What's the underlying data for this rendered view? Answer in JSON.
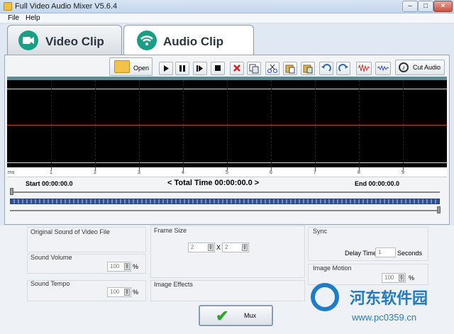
{
  "window": {
    "title": "Full Video Audio Mixer V5.6.4"
  },
  "menu": {
    "items": [
      "File",
      "Help"
    ]
  },
  "tabs": [
    {
      "label": "Video Clip",
      "icon": "camera-icon"
    },
    {
      "label": "Audio Clip",
      "icon": "wifi-icon",
      "selected": true
    }
  ],
  "toolbar": {
    "open_label": "Open",
    "cut_audio_label": "Cut Audio"
  },
  "ruler": {
    "unit": "ms",
    "ticks": [
      "1",
      "2",
      "3",
      "4",
      "5",
      "6",
      "7",
      "8",
      "9"
    ]
  },
  "timeline": {
    "start_label": "Start 00:00:00.0",
    "total_label": "< Total Time 00:00:00.0 >",
    "end_label": "End 00:00:00.0"
  },
  "options": {
    "original_sound_title": "Original Sound of Video File",
    "frame_size_title": "Frame Size",
    "frame_w": "2",
    "frame_x": "X",
    "frame_h": "2",
    "sync_title": "Sync",
    "delay_label": "Delay Time",
    "delay_value": "1",
    "delay_unit": "Seconds",
    "sound_volume_title": "Sound Volume",
    "sound_volume_value": "100",
    "sound_tempo_title": "Sound Tempo",
    "sound_tempo_value": "100",
    "image_effects_title": "Image Effects",
    "image_motion_title": "Image Motion",
    "image_motion_value": "100",
    "percent": "%"
  },
  "mux": {
    "label": "Mux"
  },
  "watermark": {
    "name": "河东软件园",
    "url": "www.pc0359.cn"
  }
}
